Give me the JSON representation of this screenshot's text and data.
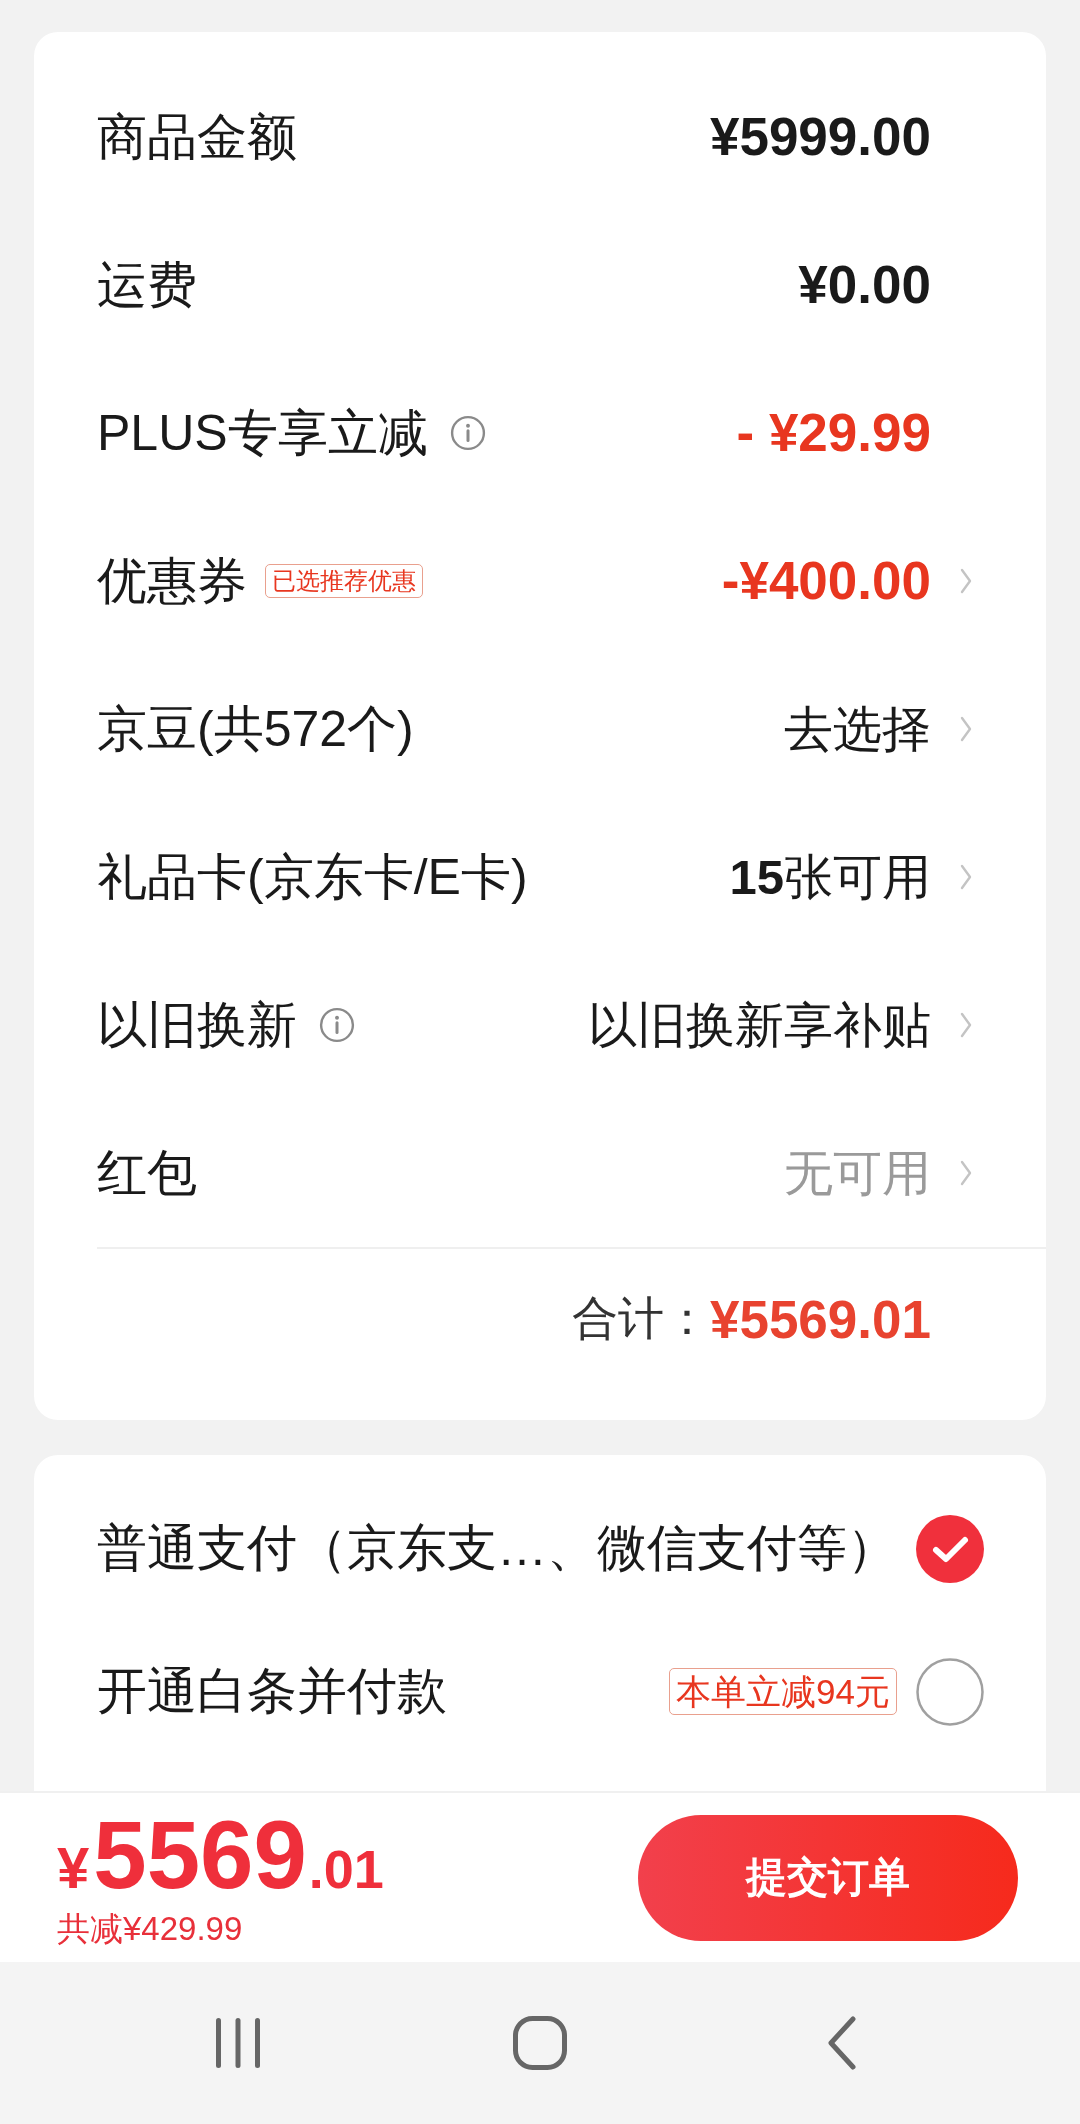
{
  "cost_summary": {
    "rows": [
      {
        "kind": "amount",
        "label": "商品金额",
        "info": false,
        "value": "¥5999.00",
        "chevron": false
      },
      {
        "kind": "amount",
        "label": "运费",
        "info": false,
        "value": "¥0.00",
        "chevron": false
      },
      {
        "kind": "discount",
        "label": "PLUS专享立减",
        "info": true,
        "value": "- ¥29.99",
        "chevron": false
      },
      {
        "kind": "discount",
        "label": "优惠券",
        "info": false,
        "tag": "已选推荐优惠",
        "value": "-¥400.00",
        "chevron": true
      },
      {
        "kind": "option",
        "label": "京豆(共572个)",
        "info": false,
        "value": "去选择",
        "chevron": true
      },
      {
        "kind": "option",
        "label": "礼品卡(京东卡/E卡)",
        "info": false,
        "value": "**15**张可用",
        "chevron": true
      },
      {
        "kind": "option",
        "label": "以旧换新",
        "info": true,
        "value": "以旧换新享补贴",
        "chevron": true
      },
      {
        "kind": "unavailable",
        "label": "红包",
        "info": false,
        "value": "无可用",
        "chevron": true
      }
    ],
    "total": {
      "label": "合计：",
      "value": "¥5569.01"
    }
  },
  "payment": {
    "options": [
      {
        "label": "普通支付（京东支…、微信支付等）",
        "selected": true
      },
      {
        "label": "开通白条并付款",
        "tag": "本单立减94元",
        "selected": false
      }
    ]
  },
  "checkout_bar": {
    "price": {
      "currency": "¥",
      "integer": "5569",
      "decimal": ".01"
    },
    "saving": "共减¥429.99",
    "submit": "提交订单"
  }
}
